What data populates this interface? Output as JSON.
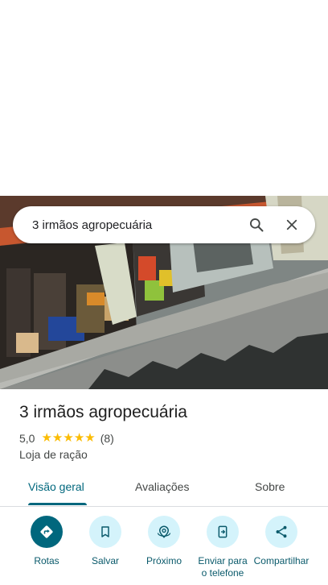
{
  "search": {
    "query": "3 irmãos agropecuária"
  },
  "place": {
    "name": "3 irmãos agropecuária",
    "rating": "5,0",
    "review_count": "(8)",
    "stars": 5,
    "category": "Loja de ração"
  },
  "tabs": [
    {
      "label": "Visão geral",
      "active": true
    },
    {
      "label": "Avaliações",
      "active": false
    },
    {
      "label": "Sobre",
      "active": false
    }
  ],
  "actions": [
    {
      "label": "Rotas",
      "icon": "directions-icon"
    },
    {
      "label": "Salvar",
      "icon": "bookmark-icon"
    },
    {
      "label": "Próximo",
      "icon": "nearby-icon"
    },
    {
      "label": "Enviar para o telefone",
      "icon": "send-to-phone-icon"
    },
    {
      "label": "Compartilhar",
      "icon": "share-icon"
    }
  ],
  "colors": {
    "accent": "#00677d",
    "chip_bg": "#d4f3fb",
    "star": "#fbbc04"
  }
}
